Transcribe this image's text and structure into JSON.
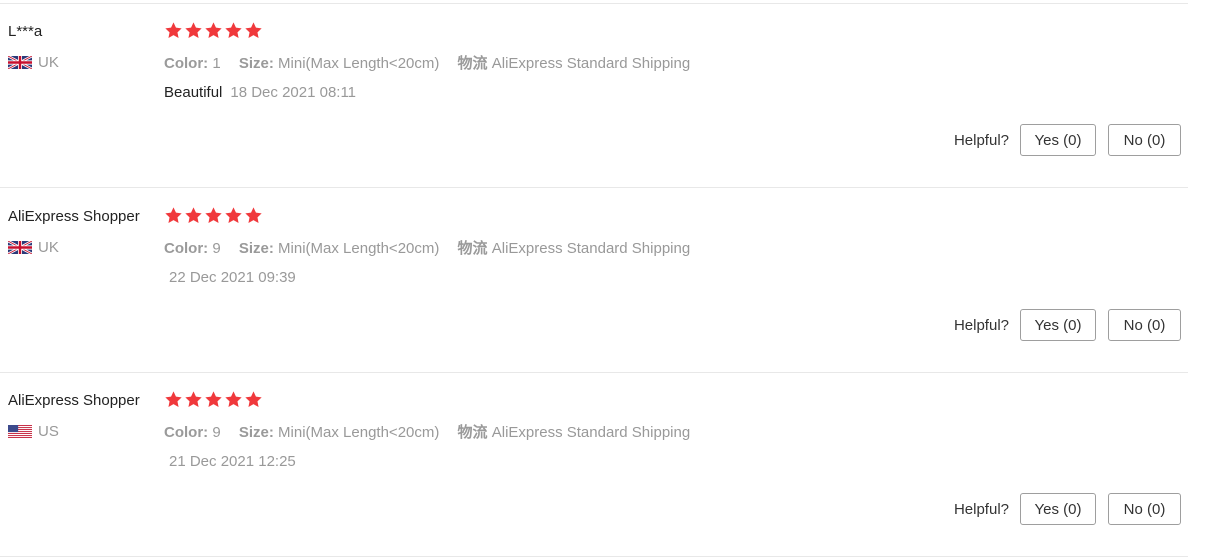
{
  "reviews": [
    {
      "user": "L***a",
      "country": "UK",
      "flag": "uk-flag-icon",
      "rating": 5,
      "color_label": "Color:",
      "color_value": "1",
      "size_label": "Size:",
      "size_value": "Mini(Max Length<20cm)",
      "shipping_label": "物流",
      "shipping_value": "AliExpress Standard Shipping",
      "feedback": "Beautiful",
      "date": "18 Dec 2021 08:11",
      "helpful_label": "Helpful?",
      "yes_label": "Yes (0)",
      "no_label": "No (0)"
    },
    {
      "user": "AliExpress Shopper",
      "country": "UK",
      "flag": "uk-flag-icon",
      "rating": 5,
      "color_label": "Color:",
      "color_value": "9",
      "size_label": "Size:",
      "size_value": "Mini(Max Length<20cm)",
      "shipping_label": "物流",
      "shipping_value": "AliExpress Standard Shipping",
      "feedback": "",
      "date": "22 Dec 2021 09:39",
      "helpful_label": "Helpful?",
      "yes_label": "Yes (0)",
      "no_label": "No (0)"
    },
    {
      "user": "AliExpress Shopper",
      "country": "US",
      "flag": "us-flag-icon",
      "rating": 5,
      "color_label": "Color:",
      "color_value": "9",
      "size_label": "Size:",
      "size_value": "Mini(Max Length<20cm)",
      "shipping_label": "物流",
      "shipping_value": "AliExpress Standard Shipping",
      "feedback": "",
      "date": "21 Dec 2021 12:25",
      "helpful_label": "Helpful?",
      "yes_label": "Yes (0)",
      "no_label": "No (0)"
    }
  ],
  "colors": {
    "star": "#f0393c",
    "divider": "#e8e8e8",
    "meta_text": "#999999"
  }
}
